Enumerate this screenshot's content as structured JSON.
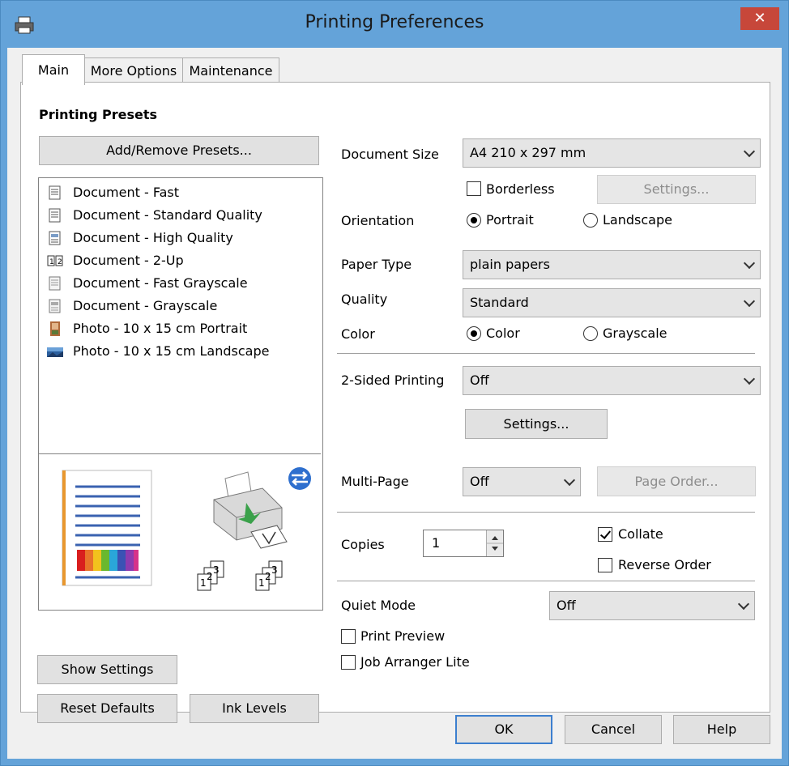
{
  "window": {
    "title": "Printing Preferences",
    "close_label": "✕"
  },
  "tabs": [
    {
      "label": "Main",
      "active": true
    },
    {
      "label": "More Options",
      "active": false
    },
    {
      "label": "Maintenance",
      "active": false
    }
  ],
  "presets": {
    "heading": "Printing Presets",
    "add_remove_label": "Add/Remove Presets...",
    "items": [
      {
        "label": "Document - Fast",
        "icon": "document-icon"
      },
      {
        "label": "Document - Standard Quality",
        "icon": "document-icon"
      },
      {
        "label": "Document - High Quality",
        "icon": "document-high-quality-icon"
      },
      {
        "label": "Document - 2-Up",
        "icon": "two-up-icon"
      },
      {
        "label": "Document - Fast Grayscale",
        "icon": "grayscale-document-icon"
      },
      {
        "label": "Document - Grayscale",
        "icon": "grayscale-document-icon"
      },
      {
        "label": "Photo - 10 x 15 cm Portrait",
        "icon": "photo-portrait-icon"
      },
      {
        "label": "Photo - 10 x 15 cm Landscape",
        "icon": "photo-landscape-icon"
      }
    ]
  },
  "preview": {
    "copy_numbers": [
      "1",
      "2",
      "3"
    ]
  },
  "settings": {
    "document_size_label": "Document Size",
    "document_size_value": "A4 210 x 297 mm",
    "borderless_label": "Borderless",
    "borderless_checked": false,
    "settings_button_label": "Settings...",
    "orientation_label": "Orientation",
    "portrait_label": "Portrait",
    "landscape_label": "Landscape",
    "orientation_selected": "Portrait",
    "paper_type_label": "Paper Type",
    "paper_type_value": "plain papers",
    "quality_label": "Quality",
    "quality_value": "Standard",
    "color_label": "Color",
    "color_option_label": "Color",
    "grayscale_label": "Grayscale",
    "color_selected": "Color",
    "two_sided_label": "2-Sided Printing",
    "two_sided_value": "Off",
    "two_sided_settings_label": "Settings...",
    "multi_page_label": "Multi-Page",
    "multi_page_value": "Off",
    "page_order_label": "Page Order...",
    "copies_label": "Copies",
    "copies_value": "1",
    "collate_label": "Collate",
    "collate_checked": true,
    "reverse_order_label": "Reverse Order",
    "reverse_order_checked": false,
    "quiet_mode_label": "Quiet Mode",
    "quiet_mode_value": "Off",
    "print_preview_label": "Print Preview",
    "print_preview_checked": false,
    "job_arranger_label": "Job Arranger Lite",
    "job_arranger_checked": false
  },
  "bottom_left": {
    "show_settings_label": "Show Settings",
    "reset_defaults_label": "Reset Defaults",
    "ink_levels_label": "Ink Levels"
  },
  "dialog_buttons": {
    "ok_label": "OK",
    "cancel_label": "Cancel",
    "help_label": "Help"
  }
}
